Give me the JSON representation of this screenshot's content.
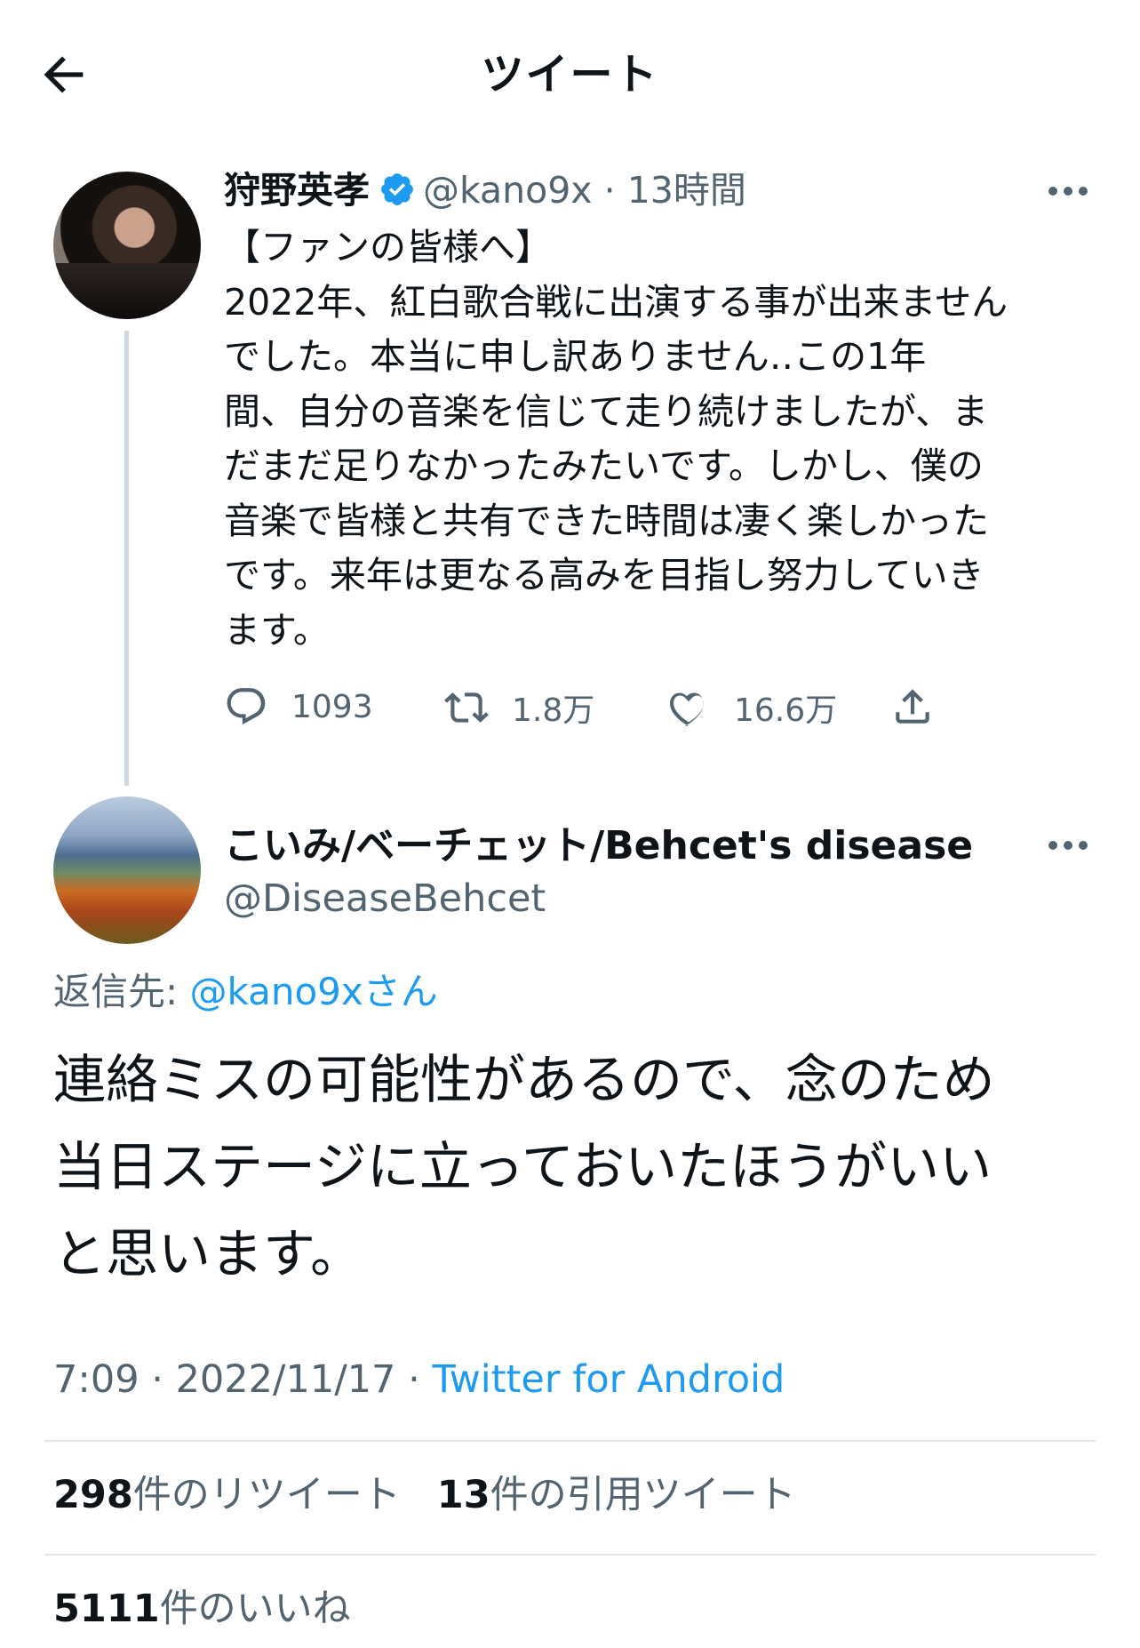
{
  "header": {
    "title": "ツイート"
  },
  "tweet": {
    "name": "狩野英孝",
    "handle": "@kano9x",
    "time": "13時間",
    "text": "【ファンの皆様へ】\n2022年、紅白歌合戦に出演する事が出来ません\nでした。本当に申し訳ありません‥この1年\n間、自分の音楽を信じて走り続けましたが、ま\nだまだ足りなかったみたいです。しかし、僕の\n音楽で皆様と共有できた時間は凄く楽しかった\nです。来年は更なる高みを目指し努力していき\nます。",
    "replies": "1093",
    "retweets": "1.8万",
    "likes": "16.6万"
  },
  "reply": {
    "name": "こいみ/ベーチェット/Behcet's disease",
    "handle": "@DiseaseBehcet",
    "reply_prefix": "返信先: ",
    "reply_to": "@kano9xさん",
    "text": "連絡ミスの可能性があるので、念のため\n当日ステージに立っておいたほうがいい\nと思います。",
    "time": "7:09",
    "date": "2022/11/17",
    "source": "Twitter for Android",
    "retweet_count": "298",
    "retweet_label": "件のリツイート",
    "quote_count": "13",
    "quote_label": "件の引用ツイート",
    "like_count": "5111",
    "like_label": "件のいいね"
  },
  "icons": [
    "back-arrow-icon",
    "verified-badge-icon",
    "more-icon",
    "reply-icon",
    "retweet-icon",
    "like-icon",
    "share-icon"
  ],
  "colors": {
    "link": "#1d9bf0",
    "secondary": "#536471",
    "text": "#0f1419",
    "divider": "#e1e7ea"
  }
}
